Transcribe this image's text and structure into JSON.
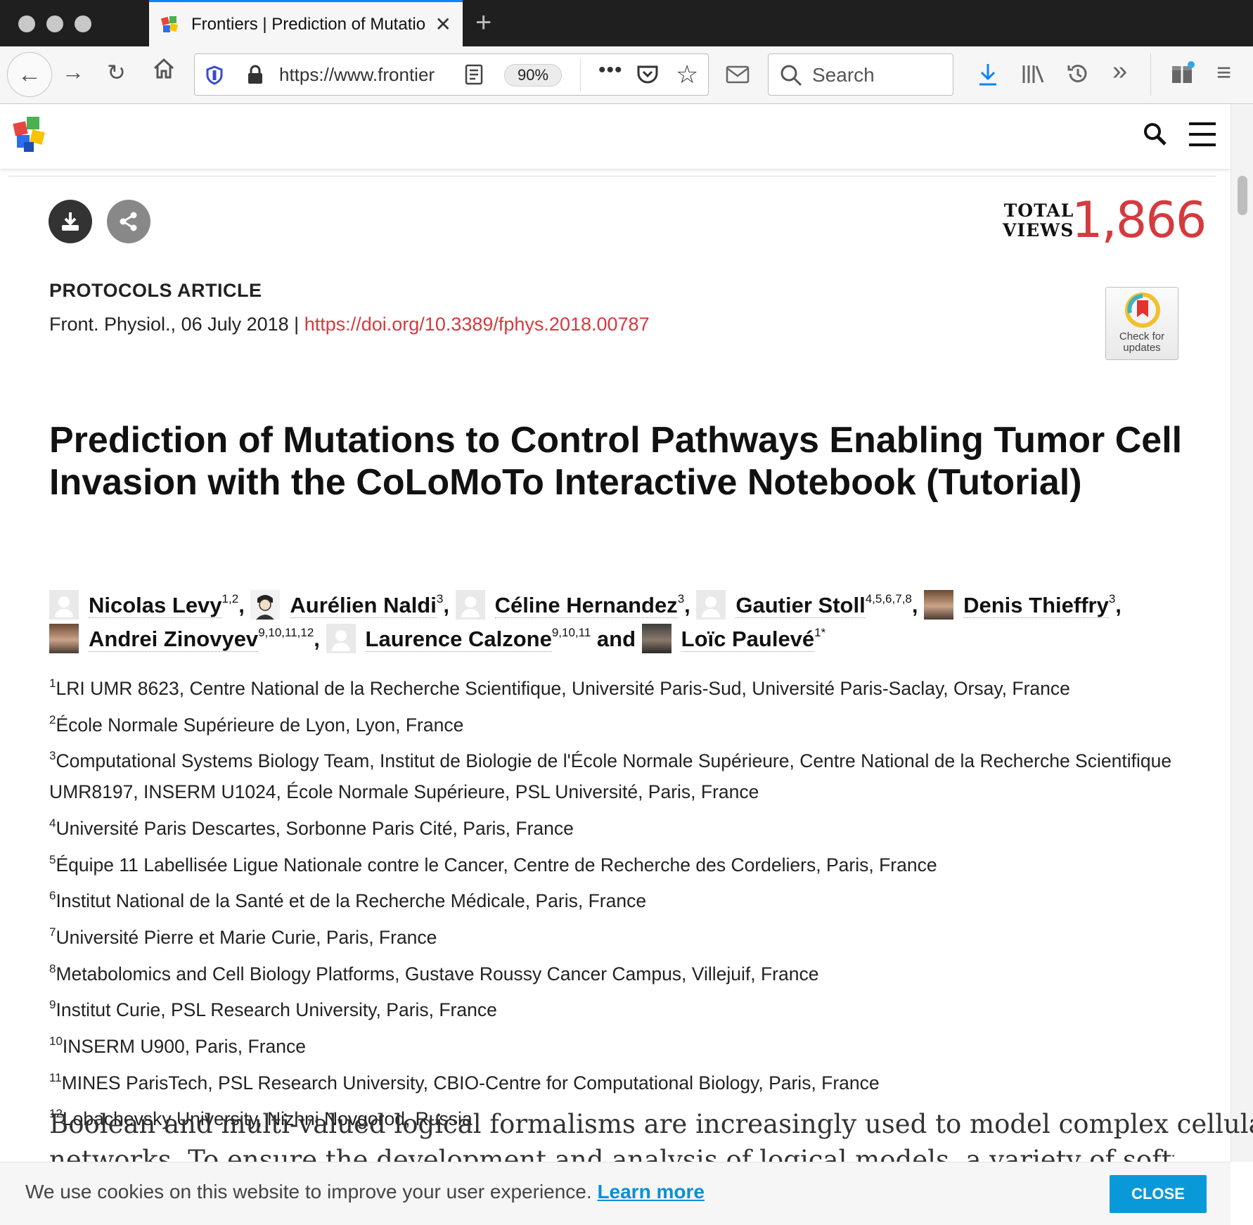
{
  "browser": {
    "tab_title": "Frontiers | Prediction of Mutatio",
    "url": "https://www.frontier",
    "zoom": "90%",
    "search_placeholder": "Search"
  },
  "article": {
    "total_views_label_1": "TOTAL",
    "total_views_label_2": "VIEWS",
    "total_views": "1,866",
    "type": "PROTOCOLS ARTICLE",
    "citation_prefix": "Front. Physiol., 06 July 2018 | ",
    "doi": "https://doi.org/10.3389/fphys.2018.00787",
    "check_updates_1": "Check for",
    "check_updates_2": "updates",
    "title": "Prediction of Mutations to Control Pathways Enabling Tumor Cell Invasion with the CoLoMoTo Interactive Notebook (Tutorial)",
    "authors": [
      {
        "name": "Nicolas Levy",
        "sup": "1,2",
        "sep": ", "
      },
      {
        "name": "Aurélien Naldi",
        "sup": "3",
        "sep": ", "
      },
      {
        "name": "Céline Hernandez",
        "sup": "3",
        "sep": ", "
      },
      {
        "name": "Gautier Stoll",
        "sup": "4,5,6,7,8",
        "sep": ", "
      },
      {
        "name": "Denis Thieffry",
        "sup": "3",
        "sep": ","
      },
      {
        "name": "Andrei Zinovyev",
        "sup": "9,10,11,12",
        "sep": ", "
      },
      {
        "name": "Laurence Calzone",
        "sup": "9,10,11",
        "sep": " and "
      },
      {
        "name": "Loïc Paulevé",
        "sup": "1*",
        "sep": ""
      }
    ],
    "affiliations": [
      {
        "n": "1",
        "text": "LRI UMR 8623, Centre National de la Recherche Scientifique, Université Paris-Sud, Université Paris-Saclay, Orsay, France"
      },
      {
        "n": "2",
        "text": "École Normale Supérieure de Lyon, Lyon, France"
      },
      {
        "n": "3",
        "text": "Computational Systems Biology Team, Institut de Biologie de l'École Normale Supérieure, Centre National de la Recherche Scientifique UMR8197, INSERM U1024, École Normale Supérieure, PSL Université, Paris, France"
      },
      {
        "n": "4",
        "text": "Université Paris Descartes, Sorbonne Paris Cité, Paris, France"
      },
      {
        "n": "5",
        "text": "Équipe 11 Labellisée Ligue Nationale contre le Cancer, Centre de Recherche des Cordeliers, Paris, France"
      },
      {
        "n": "6",
        "text": "Institut National de la Santé et de la Recherche Médicale, Paris, France"
      },
      {
        "n": "7",
        "text": "Université Pierre et Marie Curie, Paris, France"
      },
      {
        "n": "8",
        "text": "Metabolomics and Cell Biology Platforms, Gustave Roussy Cancer Campus, Villejuif, France"
      },
      {
        "n": "9",
        "text": "Institut Curie, PSL Research University, Paris, France"
      },
      {
        "n": "10",
        "text": "INSERM U900, Paris, France"
      },
      {
        "n": "11",
        "text": "MINES ParisTech, PSL Research University, CBIO-Centre for Computational Biology, Paris, France"
      },
      {
        "n": "12",
        "text": "Lobachevsky University, Nizhni Novgorod, Russia"
      }
    ],
    "abstract_line": "Boolean and multi-valued logical formalisms are increasingly used to model complex cellular",
    "abstract_line2": "networks. To ensure the development and analysis of logical models, a variety of software tools h"
  },
  "cookie": {
    "message": "We use cookies on this website to improve your user experience. ",
    "learn_more": "Learn more",
    "close": "CLOSE"
  },
  "colors": {
    "accent_red": "#d53a3f",
    "link_blue": "#0a8fd6",
    "close_bg": "#0a99d8",
    "tab_indicator": "#0a84ff"
  }
}
